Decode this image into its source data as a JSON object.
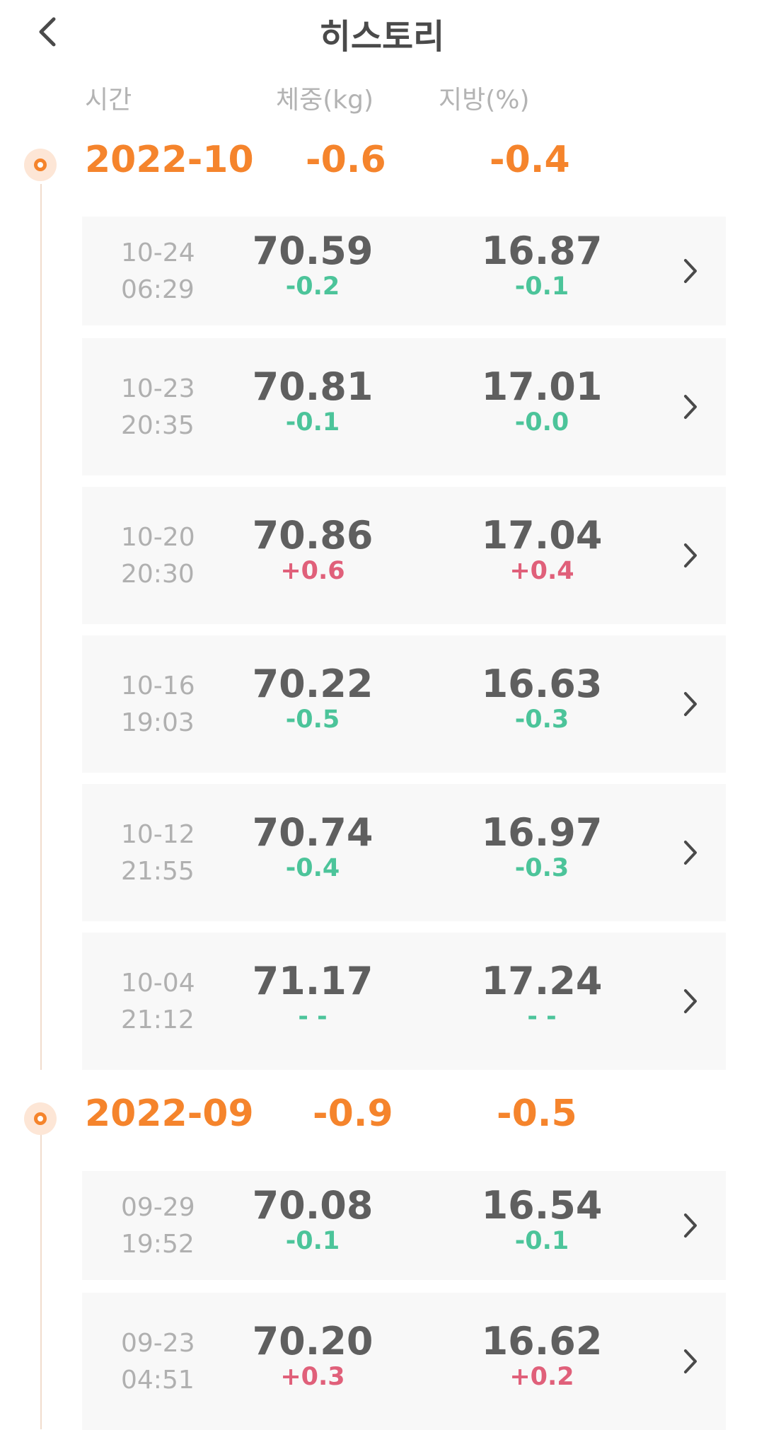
{
  "header": {
    "title": "히스토리",
    "back_icon": "chevron-left-icon"
  },
  "columns": {
    "time": "시간",
    "weight": "체중(kg)",
    "fat": "지방(%)"
  },
  "colors": {
    "accent": "#f5842c",
    "decrease": "#4cc49a",
    "increase": "#e0607a"
  },
  "months": [
    {
      "label": "2022-10",
      "weight_change": "-0.6",
      "fat_change": "-0.4",
      "entries": [
        {
          "date": "10-24",
          "time": "06:29",
          "weight": "70.59",
          "weight_delta": "-0.2",
          "fat": "16.87",
          "fat_delta": "-0.1"
        },
        {
          "date": "10-23",
          "time": "20:35",
          "weight": "70.81",
          "weight_delta": "-0.1",
          "fat": "17.01",
          "fat_delta": "-0.0"
        },
        {
          "date": "10-20",
          "time": "20:30",
          "weight": "70.86",
          "weight_delta": "+0.6",
          "fat": "17.04",
          "fat_delta": "+0.4"
        },
        {
          "date": "10-16",
          "time": "19:03",
          "weight": "70.22",
          "weight_delta": "-0.5",
          "fat": "16.63",
          "fat_delta": "-0.3"
        },
        {
          "date": "10-12",
          "time": "21:55",
          "weight": "70.74",
          "weight_delta": "-0.4",
          "fat": "16.97",
          "fat_delta": "-0.3"
        },
        {
          "date": "10-04",
          "time": "21:12",
          "weight": "71.17",
          "weight_delta": "- -",
          "fat": "17.24",
          "fat_delta": "- -"
        }
      ]
    },
    {
      "label": "2022-09",
      "weight_change": "-0.9",
      "fat_change": "-0.5",
      "entries": [
        {
          "date": "09-29",
          "time": "19:52",
          "weight": "70.08",
          "weight_delta": "-0.1",
          "fat": "16.54",
          "fat_delta": "-0.1"
        },
        {
          "date": "09-23",
          "time": "04:51",
          "weight": "70.20",
          "weight_delta": "+0.3",
          "fat": "16.62",
          "fat_delta": "+0.2"
        }
      ]
    }
  ]
}
